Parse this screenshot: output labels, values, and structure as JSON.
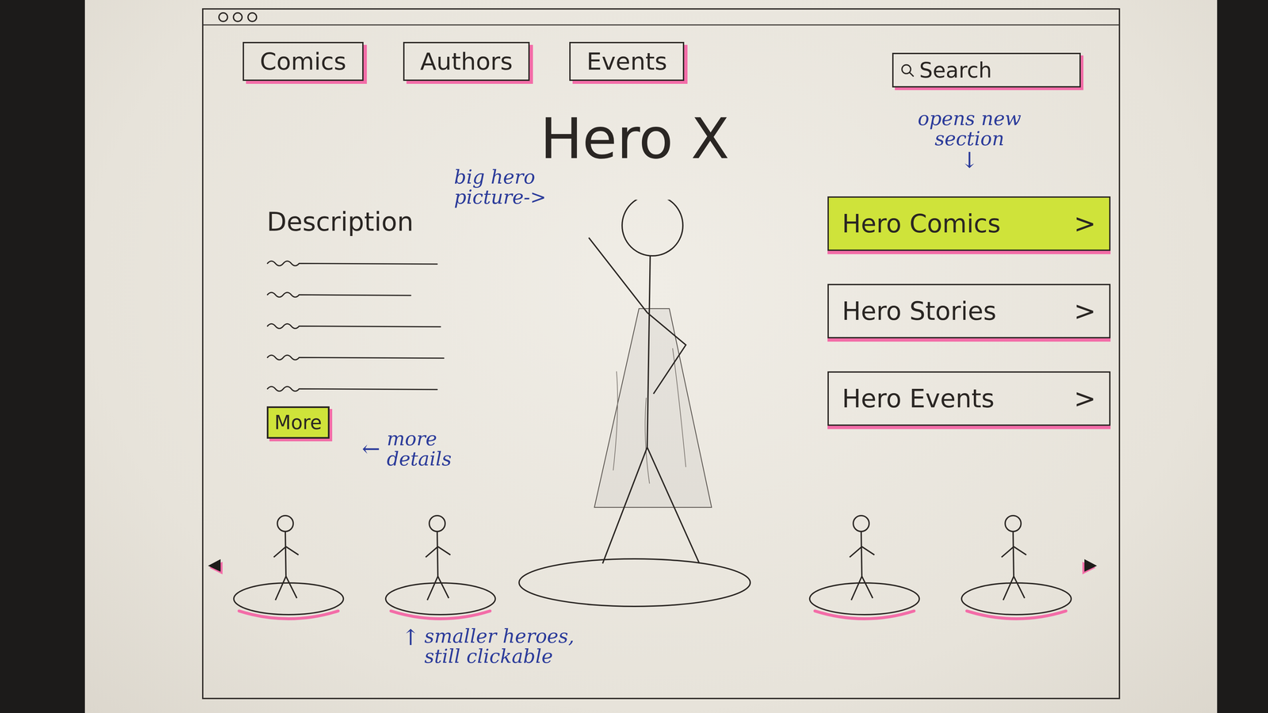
{
  "nav": {
    "items": [
      {
        "label": "Comics"
      },
      {
        "label": "Authors"
      },
      {
        "label": "Events"
      }
    ]
  },
  "search": {
    "placeholder": "Search"
  },
  "hero": {
    "title": "Hero X"
  },
  "description": {
    "heading": "Description",
    "more_button": "More"
  },
  "sections": [
    {
      "label": "Hero Comics",
      "chevron": ">",
      "highlighted": true
    },
    {
      "label": "Hero Stories",
      "chevron": ">",
      "highlighted": false
    },
    {
      "label": "Hero Events",
      "chevron": ">",
      "highlighted": false
    }
  ],
  "carousel": {
    "heroes": [
      {
        "selected": false
      },
      {
        "selected": false
      },
      {
        "selected": true
      },
      {
        "selected": false
      },
      {
        "selected": false
      }
    ]
  },
  "annotations": {
    "hero_picture": "big hero picture->",
    "sections": {
      "text": "opens new section",
      "arrow": "↓"
    },
    "more": {
      "arrow": "←",
      "text": "more details"
    },
    "carousel": {
      "arrow": "↑",
      "text": "smaller heroes, still clickable"
    }
  }
}
